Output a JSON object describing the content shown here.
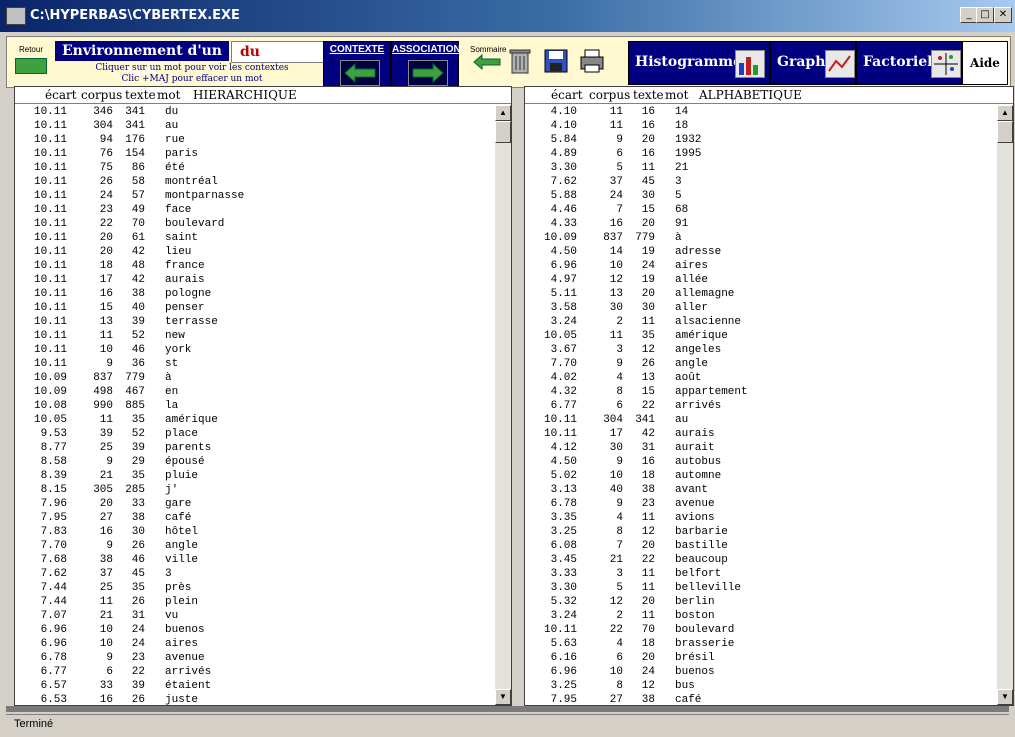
{
  "window": {
    "title": "C:\\HYPERBAS\\CYBERTEX.EXE"
  },
  "toolbar": {
    "retour_label": "Retour",
    "env_title": "Environnement d'un mot",
    "env_word": "du",
    "hint_line1": "Cliquer sur un mot pour voir les contextes",
    "hint_line2": "Clic +MAJ pour effacer un mot",
    "contexte_label": "CONTEXTE",
    "association_label": "ASSOCIATION",
    "sommaire_label": "Sommaire",
    "histogramme_label": "Histogramme",
    "graphe_label": "Graphe",
    "factorielle_label": "Factorielle",
    "aide_label": "Aide"
  },
  "left_panel": {
    "headers": {
      "ecart": "écart",
      "corpus": "corpus",
      "texte": "texte",
      "mot": "mot",
      "mode": "HIERARCHIQUE"
    },
    "rows": [
      [
        "10.11",
        "346",
        "341",
        "du"
      ],
      [
        "10.11",
        "304",
        "341",
        "au"
      ],
      [
        "10.11",
        "94",
        "176",
        "rue"
      ],
      [
        "10.11",
        "76",
        "154",
        "paris"
      ],
      [
        "10.11",
        "75",
        "86",
        "été"
      ],
      [
        "10.11",
        "26",
        "58",
        "montréal"
      ],
      [
        "10.11",
        "24",
        "57",
        "montparnasse"
      ],
      [
        "10.11",
        "23",
        "49",
        "face"
      ],
      [
        "10.11",
        "22",
        "70",
        "boulevard"
      ],
      [
        "10.11",
        "20",
        "61",
        "saint"
      ],
      [
        "10.11",
        "20",
        "42",
        "lieu"
      ],
      [
        "10.11",
        "18",
        "48",
        "france"
      ],
      [
        "10.11",
        "17",
        "42",
        "aurais"
      ],
      [
        "10.11",
        "16",
        "38",
        "pologne"
      ],
      [
        "10.11",
        "15",
        "40",
        "penser"
      ],
      [
        "10.11",
        "13",
        "39",
        "terrasse"
      ],
      [
        "10.11",
        "11",
        "52",
        "new"
      ],
      [
        "10.11",
        "10",
        "46",
        "york"
      ],
      [
        "10.11",
        "9",
        "36",
        "st"
      ],
      [
        "10.09",
        "837",
        "779",
        "à"
      ],
      [
        "10.09",
        "498",
        "467",
        "en"
      ],
      [
        "10.08",
        "990",
        "885",
        "la"
      ],
      [
        "10.05",
        "11",
        "35",
        "amérique"
      ],
      [
        "9.53",
        "39",
        "52",
        "place"
      ],
      [
        "8.77",
        "25",
        "39",
        "parents"
      ],
      [
        "8.58",
        "9",
        "29",
        "épousé"
      ],
      [
        "8.39",
        "21",
        "35",
        "pluie"
      ],
      [
        "8.15",
        "305",
        "285",
        "j'"
      ],
      [
        "7.96",
        "20",
        "33",
        "gare"
      ],
      [
        "7.95",
        "27",
        "38",
        "café"
      ],
      [
        "7.83",
        "16",
        "30",
        "hôtel"
      ],
      [
        "7.70",
        "9",
        "26",
        "angle"
      ],
      [
        "7.68",
        "38",
        "46",
        "ville"
      ],
      [
        "7.62",
        "37",
        "45",
        "3"
      ],
      [
        "7.44",
        "25",
        "35",
        "près"
      ],
      [
        "7.44",
        "11",
        "26",
        "plein"
      ],
      [
        "7.07",
        "21",
        "31",
        "vu"
      ],
      [
        "6.96",
        "10",
        "24",
        "buenos"
      ],
      [
        "6.96",
        "10",
        "24",
        "aires"
      ],
      [
        "6.78",
        "9",
        "23",
        "avenue"
      ],
      [
        "6.77",
        "6",
        "22",
        "arrivés"
      ],
      [
        "6.57",
        "33",
        "39",
        "étaient"
      ],
      [
        "6.53",
        "16",
        "26",
        "juste"
      ]
    ]
  },
  "right_panel": {
    "headers": {
      "ecart": "écart",
      "corpus": "corpus",
      "texte": "texte",
      "mot": "mot",
      "mode": "ALPHABETIQUE"
    },
    "rows": [
      [
        "4.10",
        "11",
        "16",
        "14"
      ],
      [
        "4.10",
        "11",
        "16",
        "18"
      ],
      [
        "5.84",
        "9",
        "20",
        "1932"
      ],
      [
        "4.89",
        "6",
        "16",
        "1995"
      ],
      [
        "3.30",
        "5",
        "11",
        "21"
      ],
      [
        "7.62",
        "37",
        "45",
        "3"
      ],
      [
        "5.88",
        "24",
        "30",
        "5"
      ],
      [
        "4.46",
        "7",
        "15",
        "68"
      ],
      [
        "4.33",
        "16",
        "20",
        "91"
      ],
      [
        "10.09",
        "837",
        "779",
        "à"
      ],
      [
        "4.50",
        "14",
        "19",
        "adresse"
      ],
      [
        "6.96",
        "10",
        "24",
        "aires"
      ],
      [
        "4.97",
        "12",
        "19",
        "allée"
      ],
      [
        "5.11",
        "13",
        "20",
        "allemagne"
      ],
      [
        "3.58",
        "30",
        "30",
        "aller"
      ],
      [
        "3.24",
        "2",
        "11",
        "alsacienne"
      ],
      [
        "10.05",
        "11",
        "35",
        "amérique"
      ],
      [
        "3.67",
        "3",
        "12",
        "angeles"
      ],
      [
        "7.70",
        "9",
        "26",
        "angle"
      ],
      [
        "4.02",
        "4",
        "13",
        "août"
      ],
      [
        "4.32",
        "8",
        "15",
        "appartement"
      ],
      [
        "6.77",
        "6",
        "22",
        "arrivés"
      ],
      [
        "10.11",
        "304",
        "341",
        "au"
      ],
      [
        "10.11",
        "17",
        "42",
        "aurais"
      ],
      [
        "4.12",
        "30",
        "31",
        "aurait"
      ],
      [
        "4.50",
        "9",
        "16",
        "autobus"
      ],
      [
        "5.02",
        "10",
        "18",
        "automne"
      ],
      [
        "3.13",
        "40",
        "38",
        "avant"
      ],
      [
        "6.78",
        "9",
        "23",
        "avenue"
      ],
      [
        "3.35",
        "4",
        "11",
        "avions"
      ],
      [
        "3.25",
        "8",
        "12",
        "barbarie"
      ],
      [
        "6.08",
        "7",
        "20",
        "bastille"
      ],
      [
        "3.45",
        "21",
        "22",
        "beaucoup"
      ],
      [
        "3.33",
        "3",
        "11",
        "belfort"
      ],
      [
        "3.30",
        "5",
        "11",
        "belleville"
      ],
      [
        "5.32",
        "12",
        "20",
        "berlin"
      ],
      [
        "3.24",
        "2",
        "11",
        "boston"
      ],
      [
        "10.11",
        "22",
        "70",
        "boulevard"
      ],
      [
        "5.63",
        "4",
        "18",
        "brasserie"
      ],
      [
        "6.16",
        "6",
        "20",
        "brésil"
      ],
      [
        "6.96",
        "10",
        "24",
        "buenos"
      ],
      [
        "3.25",
        "8",
        "12",
        "bus"
      ],
      [
        "7.95",
        "27",
        "38",
        "café"
      ]
    ]
  },
  "status": {
    "text": "Terminé"
  },
  "colors": {
    "title_bar": "#0a246a",
    "accent_navy": "#000080",
    "word_red": "#c00000",
    "arrow_green": "#3fa03f",
    "toolbar_bg": "#fff8d0"
  }
}
